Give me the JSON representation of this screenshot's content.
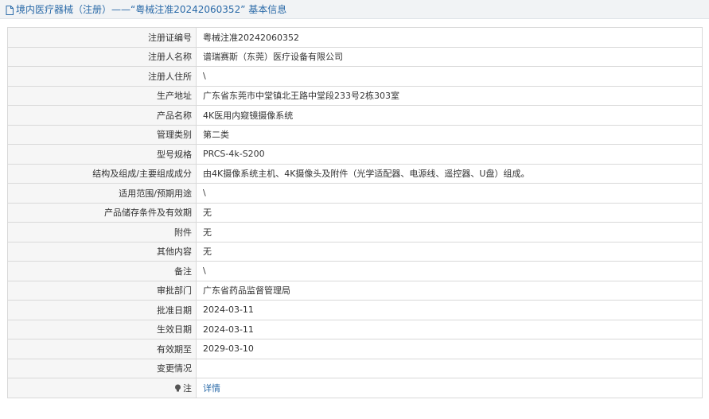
{
  "header": {
    "title": "境内医疗器械（注册）——“粤械注准20242060352” 基本信息",
    "icon": "document-icon"
  },
  "rows": [
    {
      "label": "注册证编号",
      "value": "粤械注准20242060352"
    },
    {
      "label": "注册人名称",
      "value": "谱瑞赛斯（东莞）医疗设备有限公司"
    },
    {
      "label": "注册人住所",
      "value": "\\"
    },
    {
      "label": "生产地址",
      "value": "广东省东莞市中堂镇北王路中堂段233号2栋303室"
    },
    {
      "label": "产品名称",
      "value": "4K医用内窥镜摄像系统"
    },
    {
      "label": "管理类别",
      "value": "第二类"
    },
    {
      "label": "型号规格",
      "value": "PRCS-4k-S200"
    },
    {
      "label": "结构及组成/主要组成成分",
      "value": "由4K摄像系统主机、4K摄像头及附件（光学适配器、电源线、遥控器、U盘）组成。"
    },
    {
      "label": "适用范围/预期用途",
      "value": "\\"
    },
    {
      "label": "产品储存条件及有效期",
      "value": "无"
    },
    {
      "label": "附件",
      "value": "无"
    },
    {
      "label": "其他内容",
      "value": "无"
    },
    {
      "label": "备注",
      "value": "\\"
    },
    {
      "label": "审批部门",
      "value": "广东省药品监督管理局"
    },
    {
      "label": "批准日期",
      "value": "2024-03-11"
    },
    {
      "label": "生效日期",
      "value": "2024-03-11"
    },
    {
      "label": "有效期至",
      "value": "2029-03-10"
    },
    {
      "label": "变更情况",
      "value": ""
    }
  ],
  "note_row": {
    "label": "注",
    "icon": "lightbulb-icon",
    "link_text": "详情"
  },
  "colors": {
    "link": "#2a6aa8",
    "label_bg": "#f6f6f6",
    "border": "#d9d9d9"
  }
}
